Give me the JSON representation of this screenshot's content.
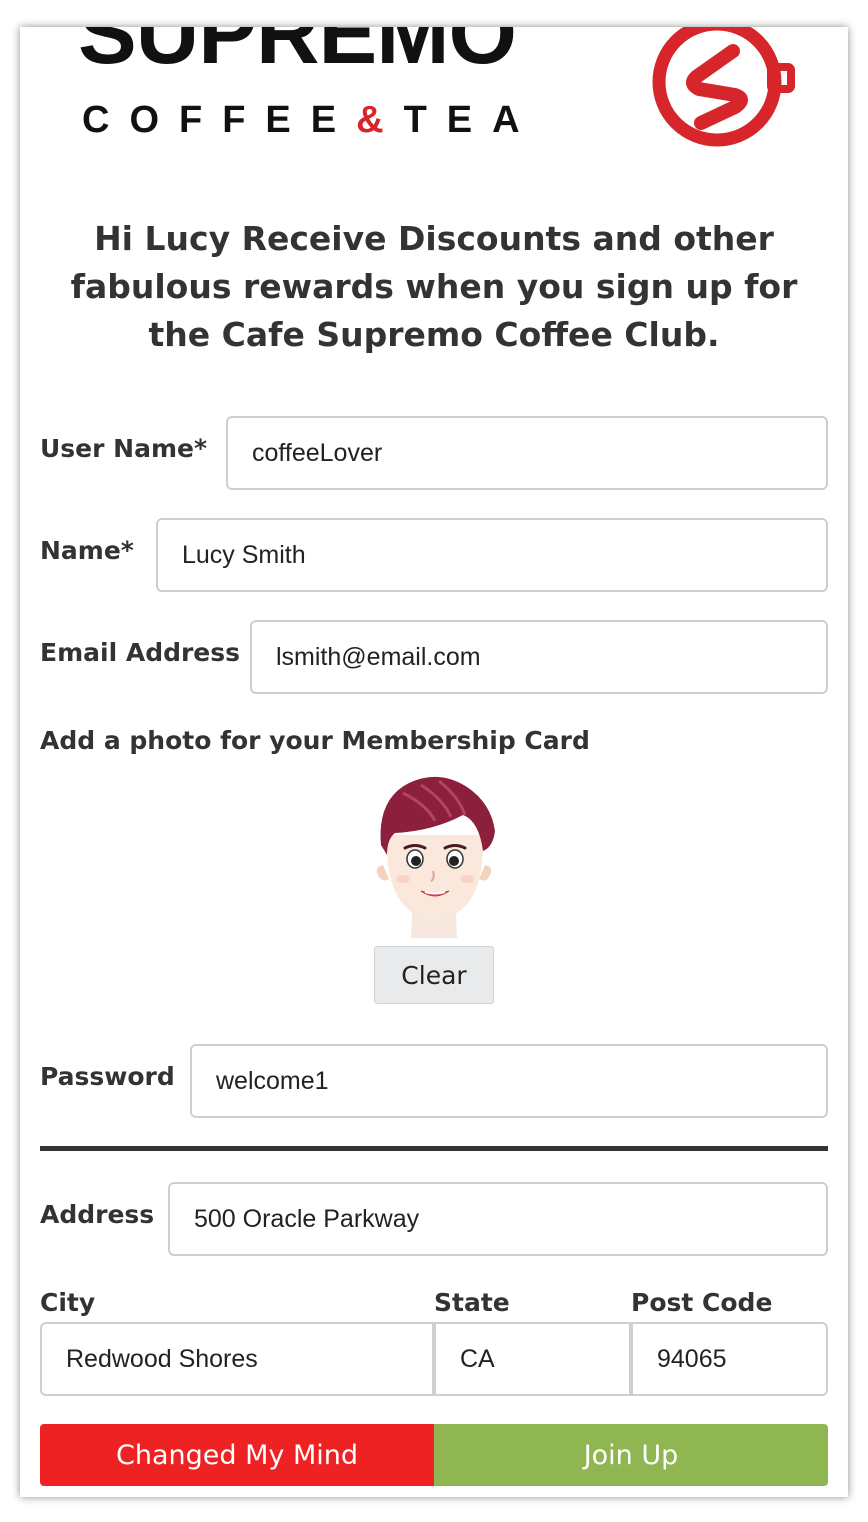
{
  "logo": {
    "word": "SUPREMO",
    "sub_left": "COFFEE",
    "sub_amp": "&",
    "sub_right": "TEA",
    "brand_color": "#d7262b"
  },
  "headline": "Hi Lucy Receive Discounts and other fabulous rewards when you sign up for the Cafe Supremo Coffee Club.",
  "form": {
    "username": {
      "label": "User Name*",
      "value": "coffeeLover"
    },
    "name": {
      "label": "Name*",
      "value": "Lucy Smith"
    },
    "email": {
      "label": "Email Address",
      "value": "lsmith@email.com"
    },
    "photo": {
      "label": "Add a photo for your Membership Card",
      "clear_label": "Clear"
    },
    "password": {
      "label": "Password",
      "value": "welcome1"
    },
    "address": {
      "label": "Address",
      "value": "500 Oracle Parkway"
    },
    "city": {
      "label": "City",
      "value": "Redwood Shores"
    },
    "state": {
      "label": "State",
      "value": "CA"
    },
    "postcode": {
      "label": "Post Code",
      "value": "94065"
    }
  },
  "buttons": {
    "cancel_label": "Changed My Mind",
    "join_label": "Join Up",
    "cancel_color": "#ee2222",
    "join_color": "#8fb650"
  }
}
